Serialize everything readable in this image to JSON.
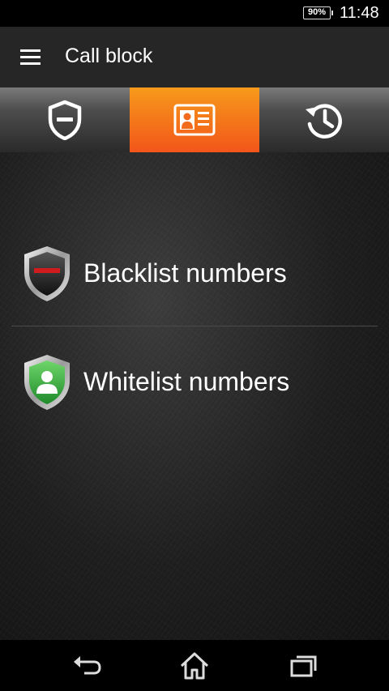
{
  "status_bar": {
    "battery": "90%",
    "time": "11:48"
  },
  "app_bar": {
    "title": "Call block",
    "menu_icon": "hamburger-menu-icon"
  },
  "tabs": [
    {
      "icon": "shield-block-icon",
      "active": false
    },
    {
      "icon": "contact-card-icon",
      "active": true
    },
    {
      "icon": "history-icon",
      "active": false
    }
  ],
  "list": {
    "items": [
      {
        "label": "Blacklist numbers",
        "icon": "blacklist-shield-icon",
        "color": "#1a1a1a"
      },
      {
        "label": "Whitelist numbers",
        "icon": "whitelist-shield-icon",
        "color": "#3aa63c"
      }
    ]
  },
  "nav_bar": {
    "back": "back-icon",
    "home": "home-icon",
    "recents": "recents-icon"
  },
  "colors": {
    "accent_start": "#f79a1b",
    "accent_end": "#f2561a",
    "blacklist_bar": "#d01c1c"
  }
}
